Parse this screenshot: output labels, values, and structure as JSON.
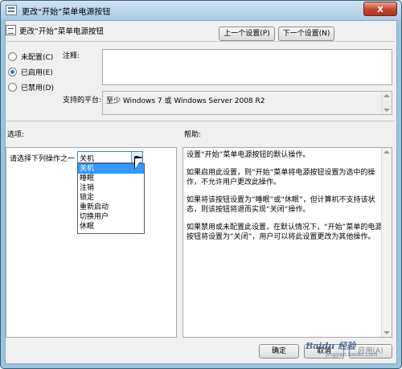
{
  "window": {
    "title": "更改“开始”菜单电源按钮",
    "close_label": "x"
  },
  "header": {
    "title": "更改“开始”菜单电源按钮",
    "prev_label": "上一个设置(P)",
    "next_label": "下一个设置(N)"
  },
  "state": {
    "options": [
      {
        "label": "未配置(C)",
        "selected": false
      },
      {
        "label": "已启用(E)",
        "selected": true
      },
      {
        "label": "已禁用(D)",
        "selected": false
      }
    ]
  },
  "comment": {
    "label": "注释:",
    "value": ""
  },
  "platform": {
    "label": "支持的平台:",
    "value": "至少 Windows 7 或 Windows Server 2008 R2"
  },
  "options_section": {
    "label": "选项:",
    "prompt": "请选择下列操作之一",
    "selected": "关机",
    "choices": [
      "关机",
      "睡眠",
      "注销",
      "锁定",
      "重新启动",
      "切换用户",
      "休眠"
    ]
  },
  "help": {
    "label": "帮助:",
    "paragraphs": [
      "设置“开始”菜单电源按钮的默认操作。",
      "如果启用此设置，则“开始”菜单将电源按钮设置为选中的操作，不允许用户更改此操作。",
      "如果将该按钮设置为“睡眠”或“休眠”，但计算机不支持该状态，则该按钮将退而实现“关闭”操作。",
      "如果禁用或未配置此设置，在默认情况下，“开始”菜单的电源按钮将设置为“关闭”，用户可以将此设置更改为其他操作。"
    ]
  },
  "footer": {
    "ok_label": "确定",
    "cancel_label": "取消",
    "apply_label": "应用(A)"
  },
  "watermark": {
    "brand": "Baidu 经验",
    "sub": "jingyan.baidu.com"
  }
}
